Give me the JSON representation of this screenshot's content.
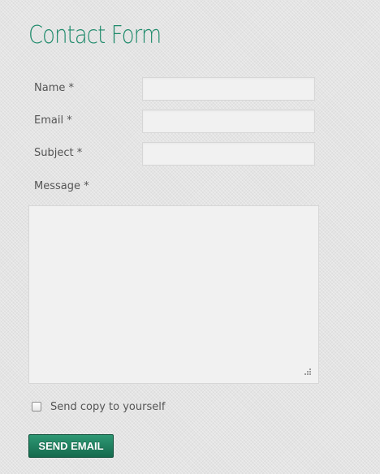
{
  "form": {
    "title": "Contact Form",
    "fields": {
      "name_label": "Name *",
      "email_label": "Email *",
      "subject_label": "Subject *",
      "message_label": "Message *"
    },
    "values": {
      "name": "",
      "email": "",
      "subject": "",
      "message": ""
    },
    "copy_label": "Send copy to yourself",
    "copy_checked": false,
    "submit_label": "SEND EMAIL"
  },
  "colors": {
    "title": "#1d8a6a",
    "button": "#1f7d5c",
    "background": "#e4e4e4",
    "field": "#f1f1f1"
  }
}
